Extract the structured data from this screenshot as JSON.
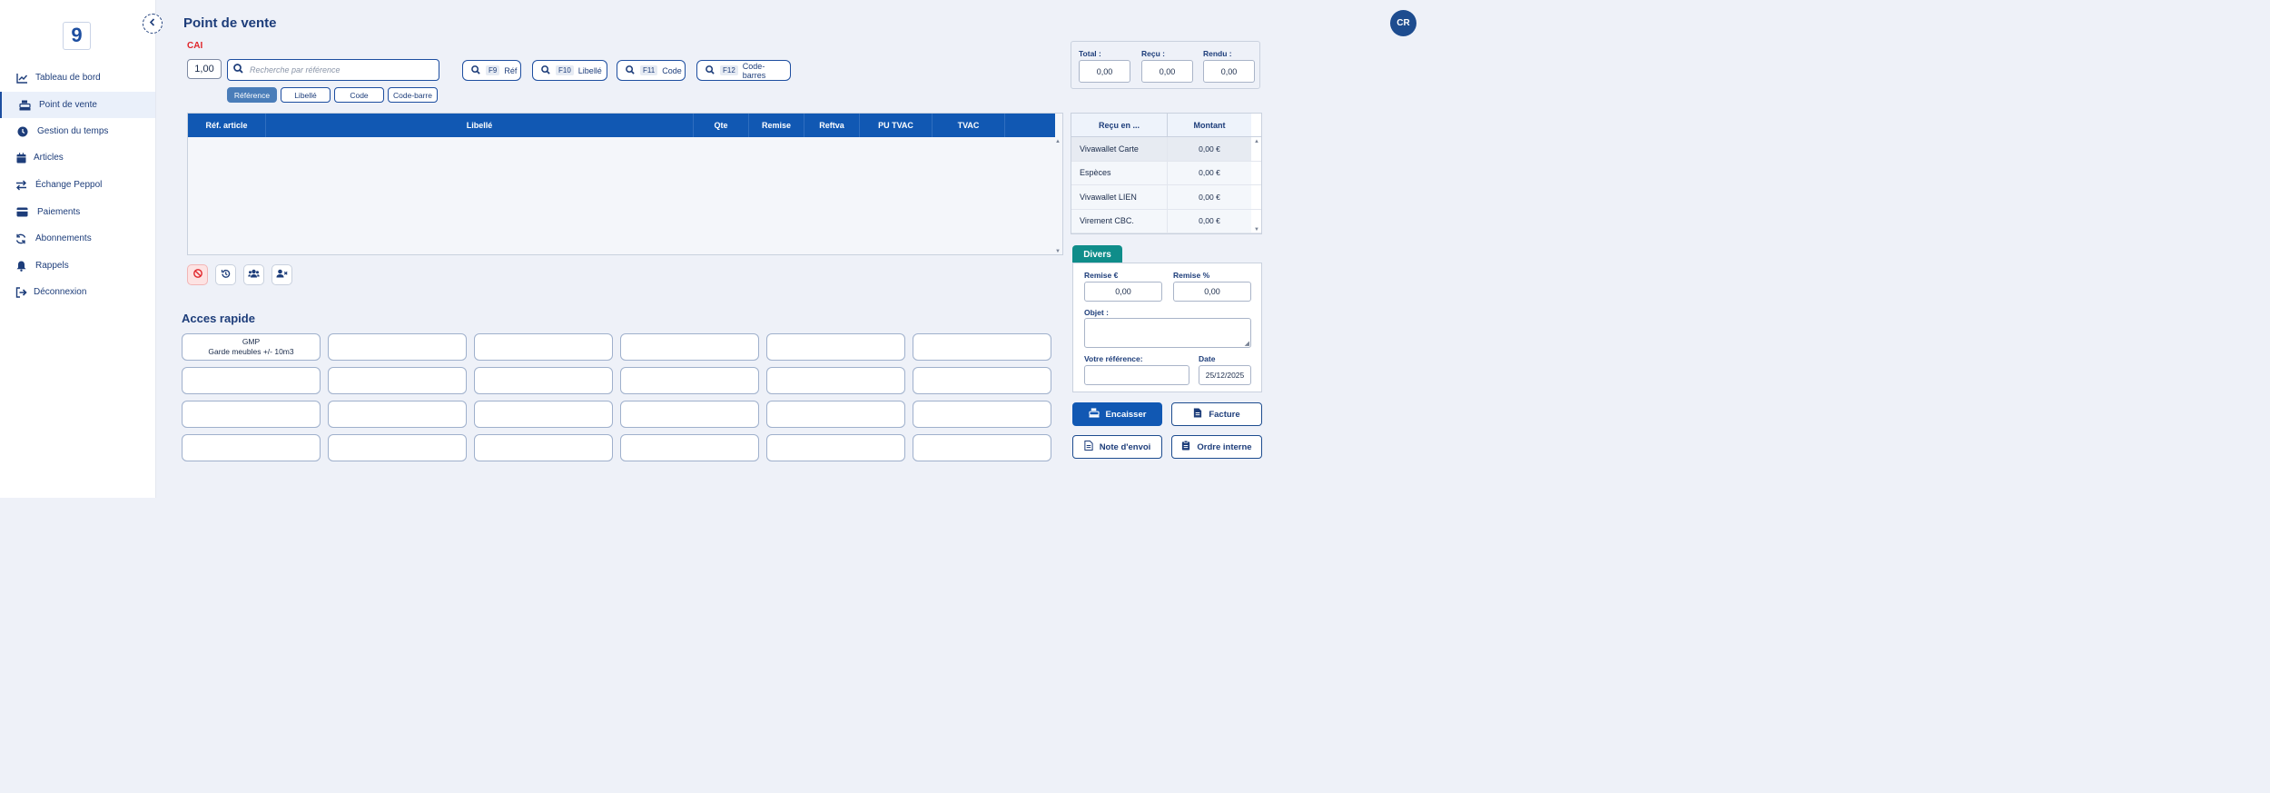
{
  "page": {
    "title": "Point de vente",
    "subtitle": "CAI"
  },
  "user": {
    "initials": "CR"
  },
  "sidebar": {
    "items": [
      {
        "label": "Tableau de bord",
        "icon": "chart-line-icon"
      },
      {
        "label": "Point de vente",
        "icon": "cash-register-icon",
        "active": true
      },
      {
        "label": "Gestion du temps",
        "icon": "clock-icon"
      },
      {
        "label": "Articles",
        "icon": "box-icon"
      },
      {
        "label": "Échange Peppol",
        "icon": "exchange-icon"
      },
      {
        "label": "Paiements",
        "icon": "credit-card-icon"
      },
      {
        "label": "Abonnements",
        "icon": "sync-icon"
      },
      {
        "label": "Rappels",
        "icon": "bell-icon"
      },
      {
        "label": "Déconnexion",
        "icon": "sign-out-icon"
      }
    ]
  },
  "search": {
    "quantity": "1,00",
    "placeholder": "Recherche par référence",
    "shortcuts": [
      {
        "key": "F9",
        "label": "Réf"
      },
      {
        "key": "F10",
        "label": "Libellé"
      },
      {
        "key": "F11",
        "label": "Code"
      },
      {
        "key": "F12",
        "label": "Code-barres"
      }
    ],
    "modes": [
      {
        "label": "Référence",
        "active": true
      },
      {
        "label": "Libellé"
      },
      {
        "label": "Code"
      },
      {
        "label": "Code-barre"
      }
    ]
  },
  "items_table": {
    "columns": [
      "Réf. article",
      "Libellé",
      "Qte",
      "Remise",
      "Reftva",
      "PU TVAC",
      "TVAC",
      ""
    ],
    "rows": []
  },
  "quick_access": {
    "title": "Acces rapide",
    "cells": [
      {
        "line1": "GMP",
        "line2": "Garde meubles +/- 10m3"
      },
      {},
      {},
      {},
      {},
      {},
      {},
      {},
      {},
      {},
      {},
      {},
      {},
      {},
      {},
      {},
      {},
      {},
      {},
      {},
      {},
      {},
      {},
      {}
    ]
  },
  "totals": {
    "total_label": "Total :",
    "total_value": "0,00",
    "recu_label": "Reçu :",
    "recu_value": "0,00",
    "rendu_label": "Rendu :",
    "rendu_value": "0,00"
  },
  "payments": {
    "col_method": "Reçu en ...",
    "col_amount": "Montant",
    "rows": [
      {
        "method": "Vivawallet Carte",
        "amount": "0,00 €"
      },
      {
        "method": "Espèces",
        "amount": "0,00 €"
      },
      {
        "method": "Vivawallet LIEN",
        "amount": "0,00 €"
      },
      {
        "method": "Virement CBC.",
        "amount": "0,00 €"
      }
    ]
  },
  "divers": {
    "tab": "Divers",
    "remise_eur_label": "Remise €",
    "remise_eur_value": "0,00",
    "remise_pct_label": "Remise %",
    "remise_pct_value": "0,00",
    "objet_label": "Objet :",
    "ref_label": "Votre référence:",
    "date_label": "Date",
    "date_value": "25/12/2025"
  },
  "actions": {
    "encaisser": "Encaisser",
    "facture": "Facture",
    "note_envoi": "Note d'envoi",
    "ordre_interne": "Ordre interne"
  },
  "colors": {
    "primary": "#1158b3",
    "accent_teal": "#0f8d8a",
    "danger": "#e0262b",
    "nav_text": "#1d3d7a"
  }
}
